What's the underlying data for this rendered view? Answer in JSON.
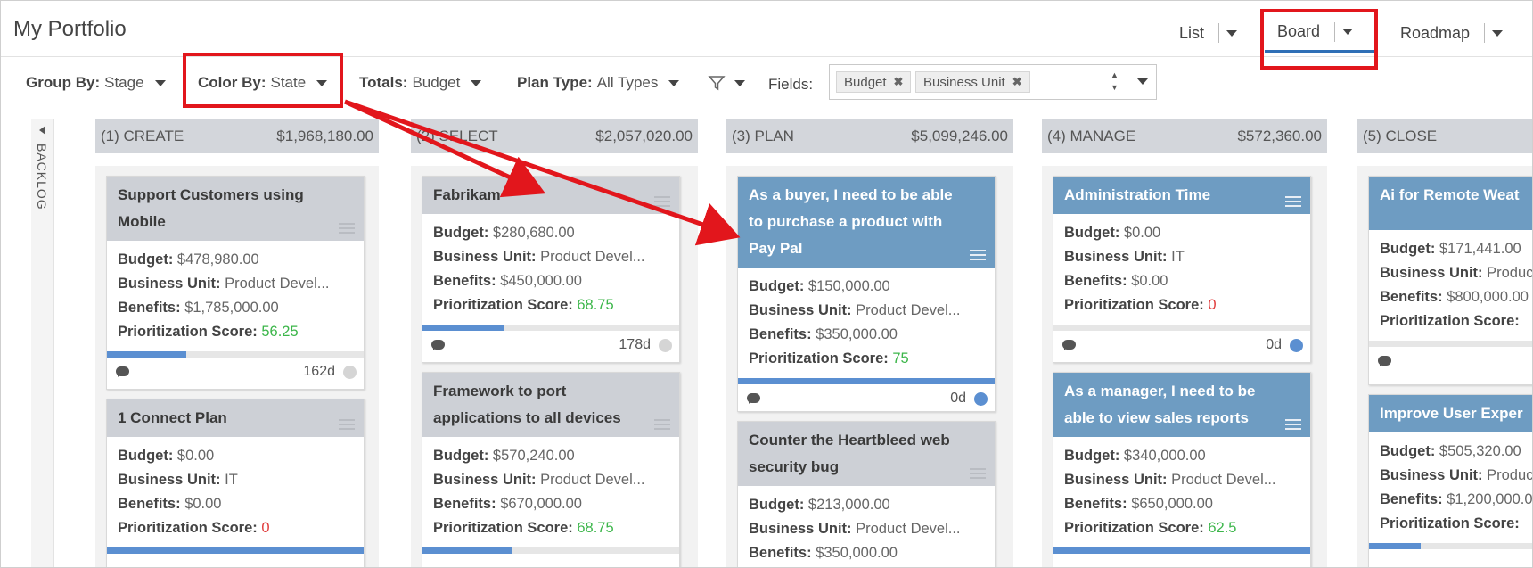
{
  "page": {
    "title": "My Portfolio"
  },
  "views": [
    {
      "label": "List"
    },
    {
      "label": "Board"
    },
    {
      "label": "Roadmap"
    }
  ],
  "toolbar": {
    "group_by": {
      "label": "Group By:",
      "value": "Stage"
    },
    "color_by": {
      "label": "Color By:",
      "value": "State"
    },
    "totals": {
      "label": "Totals:",
      "value": "Budget"
    },
    "plan_type": {
      "label": "Plan Type:",
      "value": "All Types"
    },
    "fields_label": "Fields:",
    "fields_chips": [
      "Budget",
      "Business Unit"
    ]
  },
  "backlog": {
    "label": "BACKLOG"
  },
  "field_labels": {
    "budget": "Budget:",
    "business_unit": "Business Unit:",
    "benefits": "Benefits:",
    "score": "Prioritization Score:"
  },
  "columns": [
    {
      "name": "(1) CREATE",
      "total": "$1,968,180.00",
      "cards": [
        {
          "title": "Support Customers using Mobile",
          "budget": "$478,980.00",
          "business_unit": "Product Devel...",
          "benefits": "$1,785,000.00",
          "score": "56.25",
          "days": "162d",
          "progress": 0.31
        },
        {
          "title": "1 Connect Plan",
          "budget": "$0.00",
          "business_unit": "IT",
          "benefits": "$0.00",
          "score": "0",
          "progress": 1.0
        }
      ]
    },
    {
      "name": "(2) SELECT",
      "total": "$2,057,020.00",
      "cards": [
        {
          "title": "Fabrikam",
          "budget": "$280,680.00",
          "business_unit": "Product Devel...",
          "benefits": "$450,000.00",
          "score": "68.75",
          "days": "178d",
          "progress": 0.32
        },
        {
          "title": "Framework to port applications to all devices",
          "budget": "$570,240.00",
          "business_unit": "Product Devel...",
          "benefits": "$670,000.00",
          "score": "68.75",
          "progress": 0.35
        }
      ]
    },
    {
      "name": "(3) PLAN",
      "total": "$5,099,246.00",
      "cards": [
        {
          "title": "As a buyer, I need to be able to purchase a product with Pay Pal",
          "budget": "$150,000.00",
          "business_unit": "Product Devel...",
          "benefits": "$350,000.00",
          "score": "75",
          "days": "0d",
          "progress": 1.0
        },
        {
          "title": "Counter the Heartbleed web security bug",
          "budget": "$213,000.00",
          "business_unit": "Product Devel...",
          "benefits": "$350,000.00"
        }
      ]
    },
    {
      "name": "(4) MANAGE",
      "total": "$572,360.00",
      "cards": [
        {
          "title": "Administration Time",
          "budget": "$0.00",
          "business_unit": "IT",
          "benefits": "$0.00",
          "score": "0",
          "days": "0d",
          "progress": 0.0
        },
        {
          "title": "As a manager, I need to be able to view sales reports",
          "budget": "$340,000.00",
          "business_unit": "Product Devel...",
          "benefits": "$650,000.00",
          "score": "62.5",
          "progress": 1.0
        }
      ]
    },
    {
      "name": "(5) CLOSE",
      "total": "",
      "cards": [
        {
          "title": "Ai for Remote Weat",
          "budget": "$171,441.00",
          "business_unit": "Produc",
          "benefits": "$800,000.00",
          "score_partial": "Prioritization Score: "
        },
        {
          "title": "Improve User Exper",
          "budget": "$505,320.00",
          "business_unit": "Produc",
          "benefits": "$1,200,000.0",
          "score_partial": "Prioritization Score: "
        }
      ]
    }
  ],
  "colors": {
    "accent": "#2f6fb6",
    "blue_state": "#6e9cc2",
    "grey_state": "#cdd0d6",
    "annotation": "#e2161c",
    "green": "#3cb64a",
    "red": "#e03a3a"
  }
}
